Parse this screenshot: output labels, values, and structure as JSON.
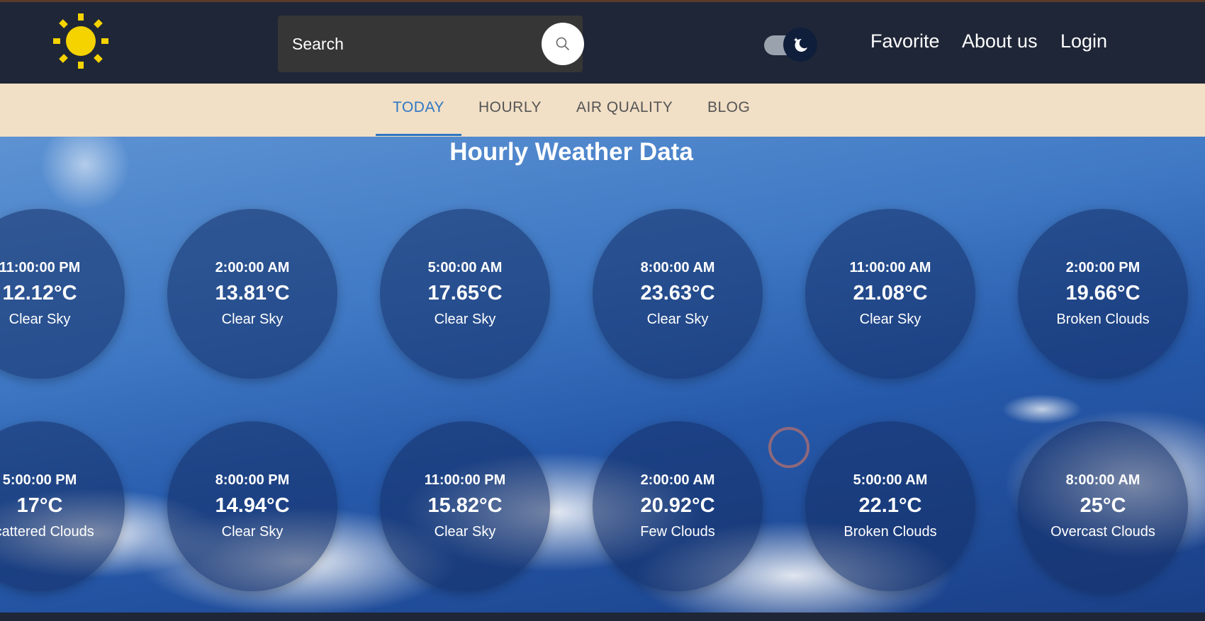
{
  "header": {
    "logo_icon": "sun-icon",
    "search": {
      "placeholder": "Search",
      "icon": "search-icon"
    },
    "theme_toggle": {
      "state": "dark",
      "icon": "moon-icon"
    },
    "nav": [
      "Favorite",
      "About us",
      "Login"
    ]
  },
  "tabs": {
    "items": [
      "TODAY",
      "HOURLY",
      "AIR QUALITY",
      "BLOG"
    ],
    "active": "TODAY"
  },
  "main": {
    "title": "Hourly Weather Data",
    "cards": [
      {
        "time": "11:00:00 PM",
        "temp": "12.12°C",
        "condition": "Clear Sky"
      },
      {
        "time": "2:00:00 AM",
        "temp": "13.81°C",
        "condition": "Clear Sky"
      },
      {
        "time": "5:00:00 AM",
        "temp": "17.65°C",
        "condition": "Clear Sky"
      },
      {
        "time": "8:00:00 AM",
        "temp": "23.63°C",
        "condition": "Clear Sky"
      },
      {
        "time": "11:00:00 AM",
        "temp": "21.08°C",
        "condition": "Clear Sky"
      },
      {
        "time": "2:00:00 PM",
        "temp": "19.66°C",
        "condition": "Broken Clouds"
      },
      {
        "time": "5:00:00 PM",
        "temp": "17°C",
        "condition": "Scattered Clouds"
      },
      {
        "time": "8:00:00 PM",
        "temp": "14.94°C",
        "condition": "Clear Sky"
      },
      {
        "time": "11:00:00 PM",
        "temp": "15.82°C",
        "condition": "Clear Sky"
      },
      {
        "time": "2:00:00 AM",
        "temp": "20.92°C",
        "condition": "Few Clouds"
      },
      {
        "time": "5:00:00 AM",
        "temp": "22.1°C",
        "condition": "Broken Clouds"
      },
      {
        "time": "8:00:00 AM",
        "temp": "25°C",
        "condition": "Overcast Clouds"
      }
    ]
  },
  "colors": {
    "header_bg": "#1f2637",
    "tab_bar_bg": "#f1dfc6",
    "tab_active": "#2d77c4",
    "sun": "#f5d300",
    "card_bg": "rgba(20,45,100,0.55)"
  }
}
